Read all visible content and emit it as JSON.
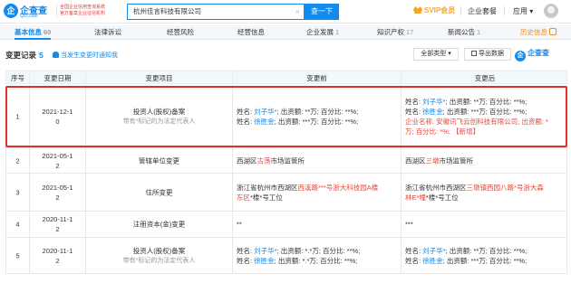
{
  "header": {
    "logo_name": "企查查",
    "logo_domain": "Qcc.com",
    "logo_mark": "企",
    "slogan_line1": "全国企业信用查询系统",
    "slogan_line2": "官方备案企业征信机构",
    "search_value": "杭州佳言科技有限公司",
    "search_button": "查一下",
    "svip": "SVIP会员",
    "nav_items": [
      "企业套餐",
      "应用"
    ]
  },
  "tabs": [
    {
      "label": "基本信息",
      "count": "60",
      "active": true
    },
    {
      "label": "法律诉讼",
      "count": "",
      "active": false
    },
    {
      "label": "经营风险",
      "count": "",
      "active": false
    },
    {
      "label": "经营信息",
      "count": "",
      "active": false
    },
    {
      "label": "企业发展",
      "count": "1",
      "active": false
    },
    {
      "label": "知识产权",
      "count": "17",
      "active": false
    },
    {
      "label": "新闻公告",
      "count": "1",
      "active": false
    },
    {
      "label": "历史信息",
      "count": "",
      "active": false
    }
  ],
  "section": {
    "title": "变更记录",
    "count": "5",
    "notify": "当发生变更时通知我",
    "filter": "全部类型",
    "export": "导出数据",
    "brand": "企查查"
  },
  "table": {
    "headers": [
      "序号",
      "变更日期",
      "变更项目",
      "变更前",
      "变更后"
    ],
    "rows": [
      {
        "no": "1",
        "date_line1": "2021-12-1",
        "date_line2": "0",
        "item": "投资人(股权)备案",
        "item_sub": "带有*标记的为法定代表人",
        "before": [
          {
            "parts": [
              [
                "姓名: ",
                ""
              ],
              [
                "刘子华*",
                "blue"
              ],
              [
                "; 出资额: **万; 百分比: **%;",
                ""
              ]
            ]
          },
          {
            "parts": [
              [
                "姓名: ",
                ""
              ],
              [
                "徐胜金",
                "blue"
              ],
              [
                "; 出资额: ***万; 百分比: **%;",
                ""
              ]
            ]
          }
        ],
        "after": [
          {
            "parts": [
              [
                "姓名: ",
                ""
              ],
              [
                "刘子华*",
                "blue"
              ],
              [
                "; 出资额: **万; 百分比: **%;",
                ""
              ]
            ]
          },
          {
            "parts": [
              [
                "姓名: ",
                ""
              ],
              [
                "徐胜金",
                "blue"
              ],
              [
                "; 出资额: ***万; 百分比: **%;",
                ""
              ]
            ]
          },
          {
            "parts": [
              [
                "企业名称: 安徽讯飞云创科技有限公司; 出资额: *",
                "red"
              ]
            ]
          },
          {
            "parts": [
              [
                "万; 百分比: *%; 【新增】",
                "red"
              ]
            ]
          }
        ]
      },
      {
        "no": "2",
        "date_line1": "2021-05-1",
        "date_line2": "2",
        "item": "管辖单位变更",
        "item_sub": "",
        "before": [
          {
            "parts": [
              [
                "西湖区",
                ""
              ],
              [
                "古荡",
                "red"
              ],
              [
                "市场监管所",
                ""
              ]
            ]
          }
        ],
        "after": [
          {
            "parts": [
              [
                "西湖区",
                ""
              ],
              [
                "三墩",
                "red"
              ],
              [
                "市场监管所",
                ""
              ]
            ]
          }
        ]
      },
      {
        "no": "3",
        "date_line1": "2021-05-1",
        "date_line2": "2",
        "item": "住所变更",
        "item_sub": "",
        "before": [
          {
            "parts": [
              [
                "浙江省杭州市西湖区",
                ""
              ],
              [
                "西溪路***号浙大科技园A楼",
                "red"
              ]
            ]
          },
          {
            "parts": [
              [
                "东区",
                "red"
              ],
              [
                "*楼*号工位",
                ""
              ]
            ]
          }
        ],
        "after": [
          {
            "parts": [
              [
                "浙江省杭州市西湖区",
                ""
              ],
              [
                "三墩镇西园八路*号浙大森",
                "red"
              ]
            ]
          },
          {
            "parts": [
              [
                "林E*幢",
                "red"
              ],
              [
                "*楼*号工位",
                ""
              ]
            ]
          }
        ]
      },
      {
        "no": "4",
        "date_line1": "2020-11-1",
        "date_line2": "2",
        "item": "注册资本(金)变更",
        "item_sub": "",
        "before": [
          {
            "parts": [
              [
                "**",
                ""
              ]
            ]
          }
        ],
        "after": [
          {
            "parts": [
              [
                "***",
                ""
              ]
            ]
          }
        ]
      },
      {
        "no": "5",
        "date_line1": "2020-11-1",
        "date_line2": "2",
        "item": "投资人(股权)备案",
        "item_sub": "带有*标记的为法定代表人",
        "before": [
          {
            "parts": [
              [
                "姓名: ",
                ""
              ],
              [
                "刘子华*",
                "blue"
              ],
              [
                "; 出资额: *.*万; 百分比: **%;",
                ""
              ]
            ]
          },
          {
            "parts": [
              [
                "姓名: ",
                ""
              ],
              [
                "徐胜金",
                "blue"
              ],
              [
                "; 出资额: *.*万; 百分比: **%;",
                ""
              ]
            ]
          }
        ],
        "after": [
          {
            "parts": [
              [
                "姓名: ",
                ""
              ],
              [
                "刘子华*",
                "blue"
              ],
              [
                "; 出资额: **万; 百分比: **%;",
                ""
              ]
            ]
          },
          {
            "parts": [
              [
                "姓名: ",
                ""
              ],
              [
                "徐胜金",
                "blue"
              ],
              [
                "; 出资额: ***万; 百分比: **%;",
                ""
              ]
            ]
          }
        ]
      }
    ]
  }
}
